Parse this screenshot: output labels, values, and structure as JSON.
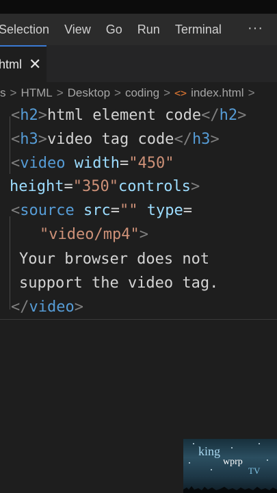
{
  "menubar": {
    "items": [
      "Selection",
      "View",
      "Go",
      "Run",
      "Terminal"
    ],
    "more": "···"
  },
  "tabs": [
    {
      "label": "html",
      "close": "✕"
    }
  ],
  "breadcrumb": {
    "items": [
      "s",
      "HTML",
      "Desktop",
      "coding",
      "index.html"
    ],
    "separator": ">",
    "file_icon": "<>",
    "trailing": ">"
  },
  "code_lines": [
    [
      {
        "t": "punct",
        "v": "<"
      },
      {
        "t": "tag",
        "v": "h2"
      },
      {
        "t": "punct",
        "v": ">"
      },
      {
        "t": "text",
        "v": "html element code"
      },
      {
        "t": "punct",
        "v": "</"
      },
      {
        "t": "tag",
        "v": "h2"
      },
      {
        "t": "punct",
        "v": ">"
      }
    ],
    [
      {
        "t": "punct",
        "v": "<"
      },
      {
        "t": "tag",
        "v": "h3"
      },
      {
        "t": "punct",
        "v": ">"
      },
      {
        "t": "text",
        "v": "video tag code"
      },
      {
        "t": "punct",
        "v": "</"
      },
      {
        "t": "tag",
        "v": "h3"
      },
      {
        "t": "punct",
        "v": ">"
      }
    ],
    [
      {
        "t": "punct",
        "v": "<"
      },
      {
        "t": "tag",
        "v": "video"
      },
      {
        "t": "text",
        "v": " "
      },
      {
        "t": "attr",
        "v": "width"
      },
      {
        "t": "text",
        "v": "="
      },
      {
        "t": "str",
        "v": "\"450\""
      }
    ],
    [
      {
        "t": "attr",
        "v": "height"
      },
      {
        "t": "text",
        "v": "="
      },
      {
        "t": "str",
        "v": "\"350\""
      },
      {
        "t": "attr",
        "v": "controls"
      },
      {
        "t": "punct",
        "v": ">"
      }
    ],
    [
      {
        "t": "punct",
        "v": "<"
      },
      {
        "t": "tag",
        "v": "source"
      },
      {
        "t": "text",
        "v": " "
      },
      {
        "t": "attr",
        "v": "src"
      },
      {
        "t": "text",
        "v": "="
      },
      {
        "t": "str",
        "v": "\"\""
      },
      {
        "t": "text",
        "v": " "
      },
      {
        "t": "attr",
        "v": "type"
      },
      {
        "t": "text",
        "v": "="
      }
    ],
    [
      {
        "t": "str",
        "v": "\"video/mp4\""
      },
      {
        "t": "punct",
        "v": ">"
      }
    ],
    [
      {
        "t": "text",
        "v": "Your browser does not"
      }
    ],
    [
      {
        "t": "text",
        "v": "support the video tag."
      }
    ],
    [
      {
        "t": "punct",
        "v": "</"
      },
      {
        "t": "tag",
        "v": "video"
      },
      {
        "t": "punct",
        "v": ">"
      }
    ]
  ],
  "watermark": {
    "line1": "king",
    "line2": "wprp",
    "line3": "TV"
  },
  "colors": {
    "tag": "#569cd6",
    "attribute": "#9cdcfe",
    "string": "#ce9178",
    "punctuation": "#808080",
    "text": "#d4d4d4",
    "html_icon": "#e37933",
    "editor_bg": "#1e1e1e",
    "menubar_bg": "#2b2b2b",
    "active_tab_border": "#3a7bd5"
  }
}
